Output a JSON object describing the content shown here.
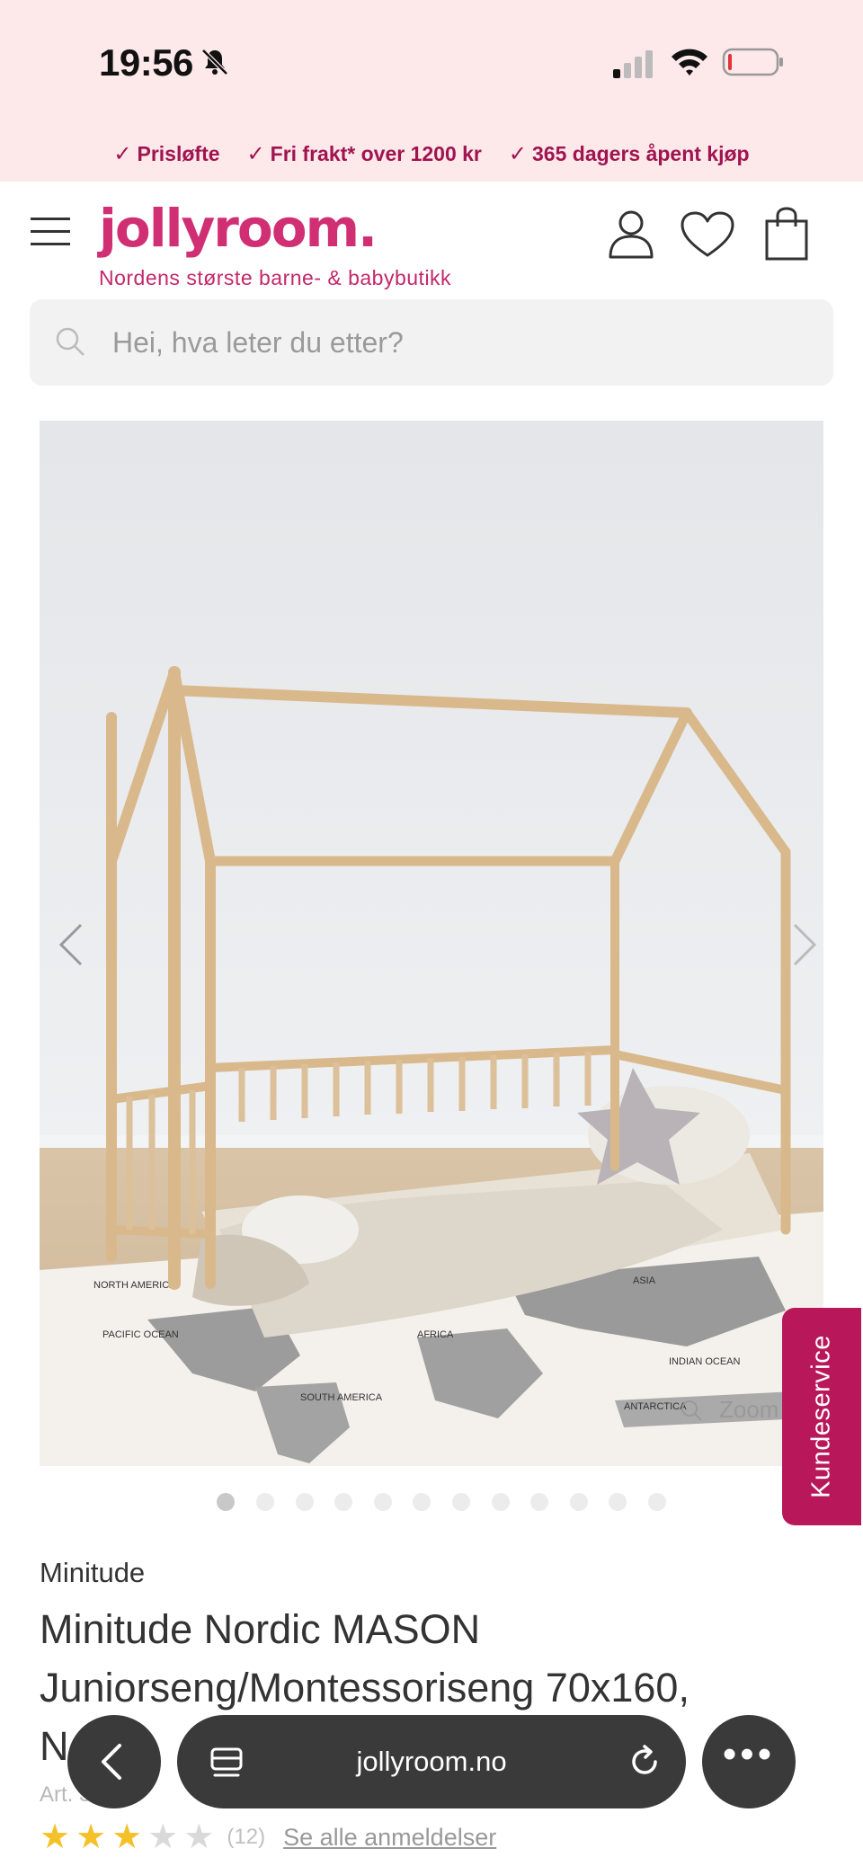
{
  "status_bar": {
    "time": "19:56",
    "icons": [
      "bell-muted-icon",
      "signal-icon",
      "wifi-icon",
      "battery-icon"
    ]
  },
  "usp": [
    {
      "icon": "check-icon",
      "label": "Prisløfte"
    },
    {
      "icon": "check-icon",
      "label": "Fri frakt* over 1200 kr"
    },
    {
      "icon": "check-icon",
      "label": "365 dagers åpent kjøp"
    }
  ],
  "header": {
    "logo": "jollyroom.",
    "tagline": "Nordens største barne- & babybutikk",
    "icons": [
      "menu-icon",
      "user-icon",
      "heart-icon",
      "bag-icon"
    ]
  },
  "search": {
    "placeholder": "Hei, hva leter du etter?"
  },
  "gallery": {
    "zoom_label": "Zoom",
    "image_count": 12,
    "active_index": 0,
    "map_labels": [
      "NORTH AMERICA",
      "PACIFIC OCEAN",
      "SOUTH AMERICA",
      "AFRICA",
      "ASIA",
      "INDIAN OCEAN",
      "ANTARCTICA"
    ]
  },
  "kundeservice": "Kundeservice",
  "product": {
    "brand": "Minitude",
    "title": "Minitude Nordic MASON Juniorseng/Montessoriseng 70x160, Natur",
    "article": "Art. 351",
    "rating": 3,
    "rating_max": 5,
    "review_count": "(12)",
    "reviews_link": "Se alle anmeldelser"
  },
  "browser": {
    "url": "jollyroom.no",
    "more_label": "•••"
  },
  "colors": {
    "brand_pink": "#d12f73",
    "usp_text": "#a01450",
    "top_bg": "#fde8ea",
    "kundeservice_bg": "#b8185a",
    "star": "#f5c12b"
  }
}
